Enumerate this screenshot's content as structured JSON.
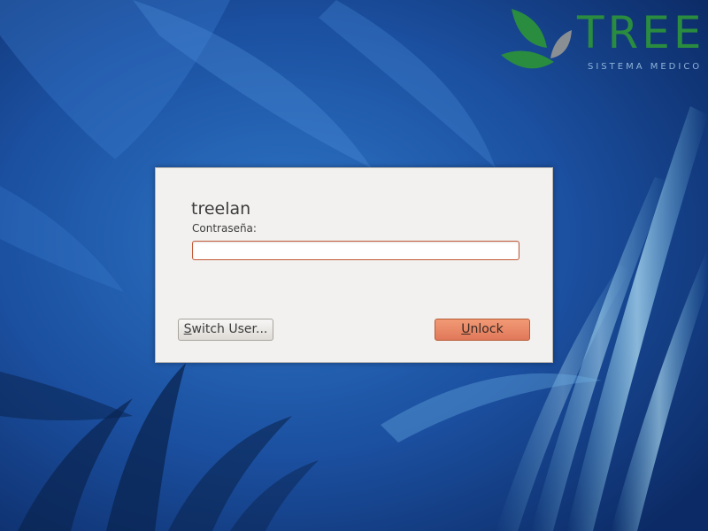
{
  "background": {
    "colors": [
      "#0d2f6e",
      "#1a4f9c",
      "#2a6fc0",
      "#6ec6ee"
    ]
  },
  "logo": {
    "word": "TREE",
    "subtitle": "SISTEMA MEDICO",
    "colors": {
      "leaf_green": "#2a8c3f",
      "leaf_gray": "#8a8f94"
    }
  },
  "dialog": {
    "username": "treelan",
    "password_label": "Contraseña:",
    "password_value": "",
    "password_border_color": "#c25a37",
    "switch_user": {
      "mnemonic": "S",
      "rest": "witch User..."
    },
    "unlock": {
      "mnemonic": "U",
      "rest": "nlock"
    },
    "unlock_color": "#e8876a"
  }
}
